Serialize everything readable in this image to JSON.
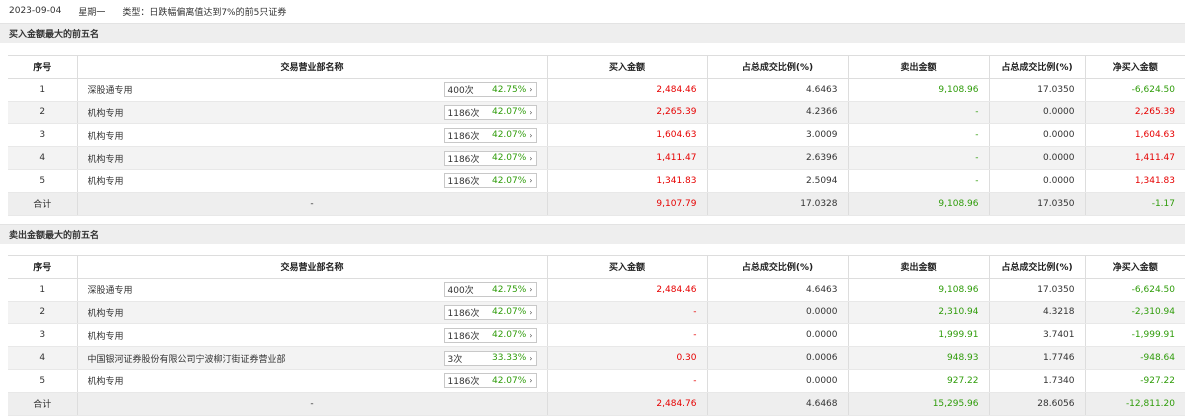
{
  "header": {
    "date": "2023-09-04",
    "weekday": "星期一",
    "type": "类型：日跌幅偏离值达到7%的前5只证券"
  },
  "columns": [
    "序号",
    "交易营业部名称",
    "买入金额",
    "占总成交比例(%)",
    "卖出金额",
    "占总成交比例(%)",
    "净买入金额"
  ],
  "buy_section": {
    "title": "买入金额最大的前五名",
    "rows": [
      {
        "no": "1",
        "name": "深股通专用",
        "count": "400次",
        "pct": "42.75%",
        "buy": "2,484.46",
        "buy_ratio": "4.6463",
        "sell": "9,108.96",
        "sell_ratio": "17.0350",
        "net": "-6,624.50"
      },
      {
        "no": "2",
        "name": "机构专用",
        "count": "1186次",
        "pct": "42.07%",
        "buy": "2,265.39",
        "buy_ratio": "4.2366",
        "sell": "-",
        "sell_ratio": "0.0000",
        "net": "2,265.39"
      },
      {
        "no": "3",
        "name": "机构专用",
        "count": "1186次",
        "pct": "42.07%",
        "buy": "1,604.63",
        "buy_ratio": "3.0009",
        "sell": "-",
        "sell_ratio": "0.0000",
        "net": "1,604.63"
      },
      {
        "no": "4",
        "name": "机构专用",
        "count": "1186次",
        "pct": "42.07%",
        "buy": "1,411.47",
        "buy_ratio": "2.6396",
        "sell": "-",
        "sell_ratio": "0.0000",
        "net": "1,411.47"
      },
      {
        "no": "5",
        "name": "机构专用",
        "count": "1186次",
        "pct": "42.07%",
        "buy": "1,341.83",
        "buy_ratio": "2.5094",
        "sell": "-",
        "sell_ratio": "0.0000",
        "net": "1,341.83"
      }
    ],
    "total": {
      "label": "合计",
      "name": "-",
      "buy": "9,107.79",
      "buy_ratio": "17.0328",
      "sell": "9,108.96",
      "sell_ratio": "17.0350",
      "net": "-1.17"
    }
  },
  "sell_section": {
    "title": "卖出金额最大的前五名",
    "rows": [
      {
        "no": "1",
        "name": "深股通专用",
        "count": "400次",
        "pct": "42.75%",
        "buy": "2,484.46",
        "buy_ratio": "4.6463",
        "sell": "9,108.96",
        "sell_ratio": "17.0350",
        "net": "-6,624.50"
      },
      {
        "no": "2",
        "name": "机构专用",
        "count": "1186次",
        "pct": "42.07%",
        "buy": "-",
        "buy_ratio": "0.0000",
        "sell": "2,310.94",
        "sell_ratio": "4.3218",
        "net": "-2,310.94"
      },
      {
        "no": "3",
        "name": "机构专用",
        "count": "1186次",
        "pct": "42.07%",
        "buy": "-",
        "buy_ratio": "0.0000",
        "sell": "1,999.91",
        "sell_ratio": "3.7401",
        "net": "-1,999.91"
      },
      {
        "no": "4",
        "name": "中国银河证券股份有限公司宁波柳汀街证券营业部",
        "count": "3次",
        "pct": "33.33%",
        "buy": "0.30",
        "buy_ratio": "0.0006",
        "sell": "948.93",
        "sell_ratio": "1.7746",
        "net": "-948.64"
      },
      {
        "no": "5",
        "name": "机构专用",
        "count": "1186次",
        "pct": "42.07%",
        "buy": "-",
        "buy_ratio": "0.0000",
        "sell": "927.22",
        "sell_ratio": "1.7340",
        "net": "-927.22"
      }
    ],
    "total": {
      "label": "合计",
      "name": "-",
      "buy": "2,484.76",
      "buy_ratio": "4.6468",
      "sell": "15,295.96",
      "sell_ratio": "28.6056",
      "net": "-12,811.20"
    }
  },
  "colors": {
    "buy": "#e60000",
    "sell": "#2f9c0a",
    "net_positive": "#e60000",
    "net_negative": "#2f9c0a",
    "stripe": "#f3f3f3"
  }
}
